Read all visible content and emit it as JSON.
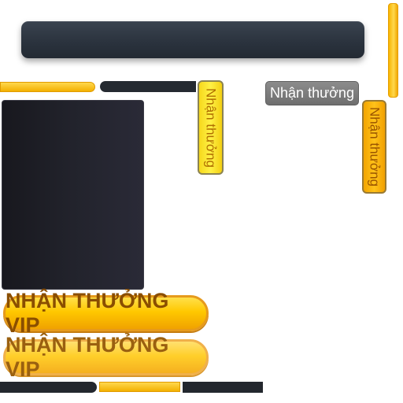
{
  "buttons": {
    "vertical_reward_1": "Nhận thưởng",
    "vertical_reward_2": "Nhận thưởng",
    "gray_reward": "Nhận thưởng",
    "vip_reward_1": "NHẬN THƯỞNG VIP",
    "vip_reward_2": "NHẬN THƯỞNG VIP"
  },
  "colors": {
    "accent_yellow": "#ffc800",
    "dark_panel": "#252a31",
    "gray_button": "#7c7c7c"
  }
}
